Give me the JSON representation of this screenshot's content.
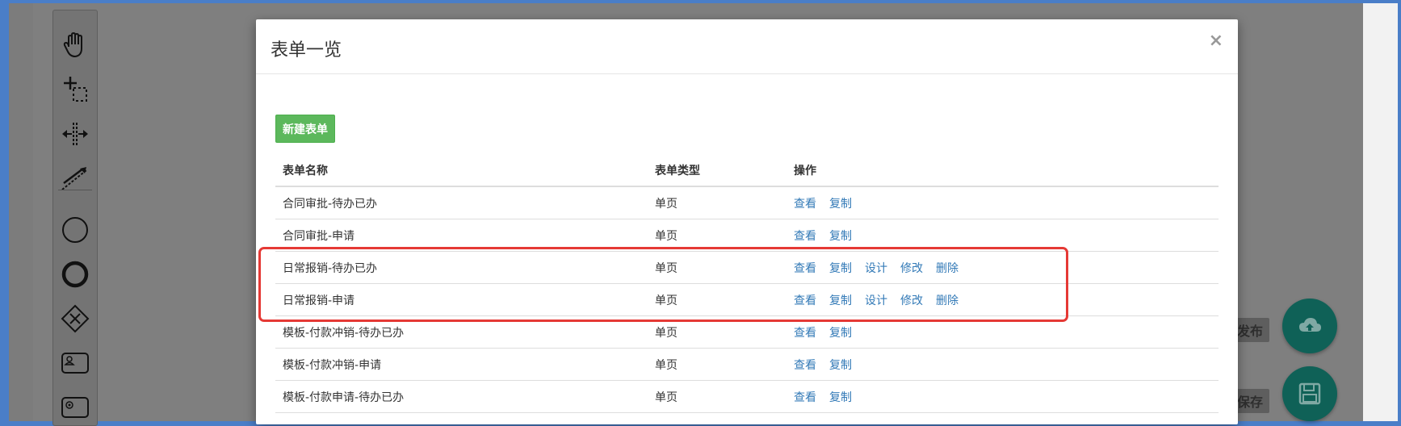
{
  "modal": {
    "title": "表单一览",
    "close": "×",
    "new_button": "新建表单"
  },
  "table": {
    "headers": [
      "表单名称",
      "表单类型",
      "操作"
    ],
    "rows": [
      {
        "name": "合同审批-待办已办",
        "type": "单页",
        "ops": [
          "查看",
          "复制"
        ]
      },
      {
        "name": "合同审批-申请",
        "type": "单页",
        "ops": [
          "查看",
          "复制"
        ]
      },
      {
        "name": "日常报销-待办已办",
        "type": "单页",
        "ops": [
          "查看",
          "复制",
          "设计",
          "修改",
          "删除"
        ]
      },
      {
        "name": "日常报销-申请",
        "type": "单页",
        "ops": [
          "查看",
          "复制",
          "设计",
          "修改",
          "删除"
        ]
      },
      {
        "name": "模板-付款冲销-待办已办",
        "type": "单页",
        "ops": [
          "查看",
          "复制"
        ]
      },
      {
        "name": "模板-付款冲销-申请",
        "type": "单页",
        "ops": [
          "查看",
          "复制"
        ]
      },
      {
        "name": "模板-付款申请-待办已办",
        "type": "单页",
        "ops": [
          "查看",
          "复制"
        ]
      }
    ]
  },
  "right_actions": {
    "publish_label": "发布",
    "save_label": "保存"
  },
  "palette_tools": [
    "hand-tool-icon",
    "lasso-tool-icon",
    "space-tool-icon",
    "connect-tool-icon",
    "start-event-icon",
    "end-event-icon",
    "gateway-icon",
    "user-task-icon",
    "service-task-icon"
  ],
  "colors": {
    "primary_link": "#337ab7",
    "success_button": "#5cb85c",
    "highlight_border": "#e53935",
    "fab": "#0f6157"
  }
}
